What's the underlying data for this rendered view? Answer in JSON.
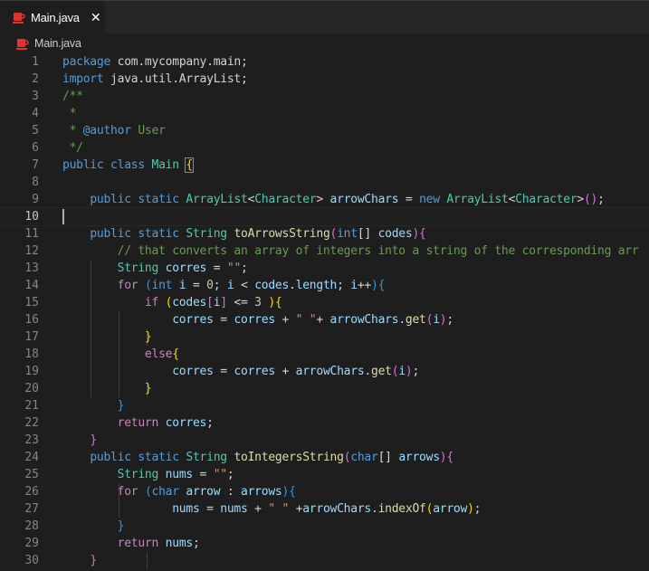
{
  "tab": {
    "label": "Main.java",
    "close": "✕",
    "icon": "java-coffee-icon"
  },
  "breadcrumb": {
    "label": "Main.java",
    "icon": "java-coffee-icon"
  },
  "editor": {
    "current_line": 10,
    "token_colors": {
      "keyword": "#569cd6",
      "control": "#c586c0",
      "type": "#4ec9b0",
      "function": "#dcdcaa",
      "variable": "#9cdcfe",
      "string": "#ce9178",
      "number": "#b5cea8",
      "comment": "#6a9955"
    },
    "lines": [
      {
        "n": "1",
        "tokens": [
          [
            "keyword",
            "package"
          ],
          [
            "plain",
            " com.mycompany.main;"
          ]
        ]
      },
      {
        "n": "2",
        "tokens": [
          [
            "keyword",
            "import"
          ],
          [
            "plain",
            " java.util.ArrayList;"
          ]
        ]
      },
      {
        "n": "3",
        "tokens": [
          [
            "comment",
            "/**"
          ]
        ]
      },
      {
        "n": "4",
        "tokens": [
          [
            "comment",
            " *"
          ]
        ]
      },
      {
        "n": "5",
        "tokens": [
          [
            "comment",
            " * "
          ],
          [
            "keyword",
            "@author"
          ],
          [
            "comment",
            " User"
          ]
        ]
      },
      {
        "n": "6",
        "tokens": [
          [
            "comment",
            " */"
          ]
        ]
      },
      {
        "n": "7",
        "tokens": [
          [
            "keyword",
            "public"
          ],
          [
            "plain",
            " "
          ],
          [
            "keyword",
            "class"
          ],
          [
            "plain",
            " "
          ],
          [
            "type",
            "Main"
          ],
          [
            "plain",
            " "
          ],
          [
            "brace1b",
            "{"
          ]
        ]
      },
      {
        "n": "8",
        "tokens": []
      },
      {
        "n": "9",
        "tokens": [
          [
            "plain",
            "    "
          ],
          [
            "keyword",
            "public"
          ],
          [
            "plain",
            " "
          ],
          [
            "keyword",
            "static"
          ],
          [
            "plain",
            " "
          ],
          [
            "type",
            "ArrayList"
          ],
          [
            "plain",
            "<"
          ],
          [
            "type",
            "Character"
          ],
          [
            "plain",
            "> "
          ],
          [
            "var",
            "arrowChars"
          ],
          [
            "plain",
            " = "
          ],
          [
            "keyword",
            "new"
          ],
          [
            "plain",
            " "
          ],
          [
            "type",
            "ArrayList"
          ],
          [
            "plain",
            "<"
          ],
          [
            "type",
            "Character"
          ],
          [
            "plain",
            ">"
          ],
          [
            "brace2",
            "()"
          ],
          [
            "plain",
            ";"
          ]
        ]
      },
      {
        "n": "10",
        "tokens": []
      },
      {
        "n": "11",
        "tokens": [
          [
            "plain",
            "    "
          ],
          [
            "keyword",
            "public"
          ],
          [
            "plain",
            " "
          ],
          [
            "keyword",
            "static"
          ],
          [
            "plain",
            " "
          ],
          [
            "type",
            "String"
          ],
          [
            "plain",
            " "
          ],
          [
            "func",
            "toArrowsString"
          ],
          [
            "brace2",
            "("
          ],
          [
            "keyword",
            "int"
          ],
          [
            "plain",
            "[] "
          ],
          [
            "var",
            "codes"
          ],
          [
            "brace2",
            ")"
          ],
          [
            "brace2",
            "{"
          ]
        ]
      },
      {
        "n": "12",
        "tokens": [
          [
            "plain",
            "        "
          ],
          [
            "comment",
            "// that converts an array of integers into a string of the corresponding arr"
          ]
        ]
      },
      {
        "n": "13",
        "tokens": [
          [
            "plain",
            "        "
          ],
          [
            "type",
            "String"
          ],
          [
            "plain",
            " "
          ],
          [
            "var",
            "corres"
          ],
          [
            "plain",
            " = "
          ],
          [
            "string",
            "\"\""
          ],
          [
            "plain",
            ";"
          ]
        ]
      },
      {
        "n": "14",
        "tokens": [
          [
            "plain",
            "        "
          ],
          [
            "control",
            "for"
          ],
          [
            "plain",
            " "
          ],
          [
            "brace3",
            "("
          ],
          [
            "keyword",
            "int"
          ],
          [
            "plain",
            " "
          ],
          [
            "var",
            "i"
          ],
          [
            "plain",
            " = "
          ],
          [
            "number",
            "0"
          ],
          [
            "plain",
            "; "
          ],
          [
            "var",
            "i"
          ],
          [
            "plain",
            " < "
          ],
          [
            "var",
            "codes"
          ],
          [
            "plain",
            "."
          ],
          [
            "var",
            "length"
          ],
          [
            "plain",
            "; "
          ],
          [
            "var",
            "i"
          ],
          [
            "plain",
            "++"
          ],
          [
            "brace3",
            ")"
          ],
          [
            "brace3",
            "{"
          ]
        ]
      },
      {
        "n": "15",
        "tokens": [
          [
            "plain",
            "            "
          ],
          [
            "control",
            "if"
          ],
          [
            "plain",
            " "
          ],
          [
            "brace1",
            "("
          ],
          [
            "var",
            "codes"
          ],
          [
            "brace2",
            "["
          ],
          [
            "var",
            "i"
          ],
          [
            "brace2",
            "]"
          ],
          [
            "plain",
            " <= "
          ],
          [
            "number",
            "3"
          ],
          [
            "plain",
            " "
          ],
          [
            "brace1",
            ")"
          ],
          [
            "brace1",
            "{"
          ]
        ]
      },
      {
        "n": "16",
        "tokens": [
          [
            "plain",
            "                "
          ],
          [
            "var",
            "corres"
          ],
          [
            "plain",
            " = "
          ],
          [
            "var",
            "corres"
          ],
          [
            "plain",
            " + "
          ],
          [
            "string",
            "\" \""
          ],
          [
            "plain",
            "+ "
          ],
          [
            "var",
            "arrowChars"
          ],
          [
            "plain",
            "."
          ],
          [
            "func",
            "get"
          ],
          [
            "brace2",
            "("
          ],
          [
            "var",
            "i"
          ],
          [
            "brace2",
            ")"
          ],
          [
            "plain",
            ";"
          ]
        ]
      },
      {
        "n": "17",
        "tokens": [
          [
            "plain",
            "            "
          ],
          [
            "brace1",
            "}"
          ]
        ]
      },
      {
        "n": "18",
        "tokens": [
          [
            "plain",
            "            "
          ],
          [
            "control",
            "else"
          ],
          [
            "brace1",
            "{"
          ]
        ]
      },
      {
        "n": "19",
        "tokens": [
          [
            "plain",
            "                "
          ],
          [
            "var",
            "corres"
          ],
          [
            "plain",
            " = "
          ],
          [
            "var",
            "corres"
          ],
          [
            "plain",
            " + "
          ],
          [
            "var",
            "arrowChars"
          ],
          [
            "plain",
            "."
          ],
          [
            "func",
            "get"
          ],
          [
            "brace2",
            "("
          ],
          [
            "var",
            "i"
          ],
          [
            "brace2",
            ")"
          ],
          [
            "plain",
            ";"
          ]
        ]
      },
      {
        "n": "20",
        "tokens": [
          [
            "plain",
            "            "
          ],
          [
            "brace1",
            "}"
          ]
        ]
      },
      {
        "n": "21",
        "tokens": [
          [
            "plain",
            "        "
          ],
          [
            "brace3",
            "}"
          ]
        ]
      },
      {
        "n": "22",
        "tokens": [
          [
            "plain",
            "        "
          ],
          [
            "control",
            "return"
          ],
          [
            "plain",
            " "
          ],
          [
            "var",
            "corres"
          ],
          [
            "plain",
            ";"
          ]
        ]
      },
      {
        "n": "23",
        "tokens": [
          [
            "plain",
            "    "
          ],
          [
            "brace2",
            "}"
          ]
        ]
      },
      {
        "n": "24",
        "tokens": [
          [
            "plain",
            "    "
          ],
          [
            "keyword",
            "public"
          ],
          [
            "plain",
            " "
          ],
          [
            "keyword",
            "static"
          ],
          [
            "plain",
            " "
          ],
          [
            "type",
            "String"
          ],
          [
            "plain",
            " "
          ],
          [
            "func",
            "toIntegersString"
          ],
          [
            "brace2",
            "("
          ],
          [
            "keyword",
            "char"
          ],
          [
            "plain",
            "[] "
          ],
          [
            "var",
            "arrows"
          ],
          [
            "brace2",
            ")"
          ],
          [
            "brace2",
            "{"
          ]
        ]
      },
      {
        "n": "25",
        "tokens": [
          [
            "plain",
            "        "
          ],
          [
            "type",
            "String"
          ],
          [
            "plain",
            " "
          ],
          [
            "var",
            "nums"
          ],
          [
            "plain",
            " = "
          ],
          [
            "string",
            "\"\""
          ],
          [
            "plain",
            ";"
          ]
        ]
      },
      {
        "n": "26",
        "tokens": [
          [
            "plain",
            "        "
          ],
          [
            "control",
            "for"
          ],
          [
            "plain",
            " "
          ],
          [
            "brace3",
            "("
          ],
          [
            "keyword",
            "char"
          ],
          [
            "plain",
            " "
          ],
          [
            "var",
            "arrow"
          ],
          [
            "plain",
            " : "
          ],
          [
            "var",
            "arrows"
          ],
          [
            "brace3",
            ")"
          ],
          [
            "brace3",
            "{"
          ]
        ]
      },
      {
        "n": "27",
        "tokens": [
          [
            "plain",
            "                "
          ],
          [
            "var",
            "nums"
          ],
          [
            "plain",
            " = "
          ],
          [
            "var",
            "nums"
          ],
          [
            "plain",
            " + "
          ],
          [
            "string",
            "\" \""
          ],
          [
            "plain",
            " +"
          ],
          [
            "var",
            "arrowChars"
          ],
          [
            "plain",
            "."
          ],
          [
            "func",
            "indexOf"
          ],
          [
            "brace1",
            "("
          ],
          [
            "var",
            "arrow"
          ],
          [
            "brace1",
            ")"
          ],
          [
            "plain",
            ";"
          ]
        ]
      },
      {
        "n": "28",
        "tokens": [
          [
            "plain",
            "        "
          ],
          [
            "brace3",
            "}"
          ]
        ]
      },
      {
        "n": "29",
        "tokens": [
          [
            "plain",
            "        "
          ],
          [
            "control",
            "return"
          ],
          [
            "plain",
            " "
          ],
          [
            "var",
            "nums"
          ],
          [
            "plain",
            ";"
          ]
        ]
      },
      {
        "n": "30",
        "tokens": [
          [
            "plain",
            "    "
          ],
          [
            "brace2",
            "}"
          ]
        ]
      }
    ]
  }
}
